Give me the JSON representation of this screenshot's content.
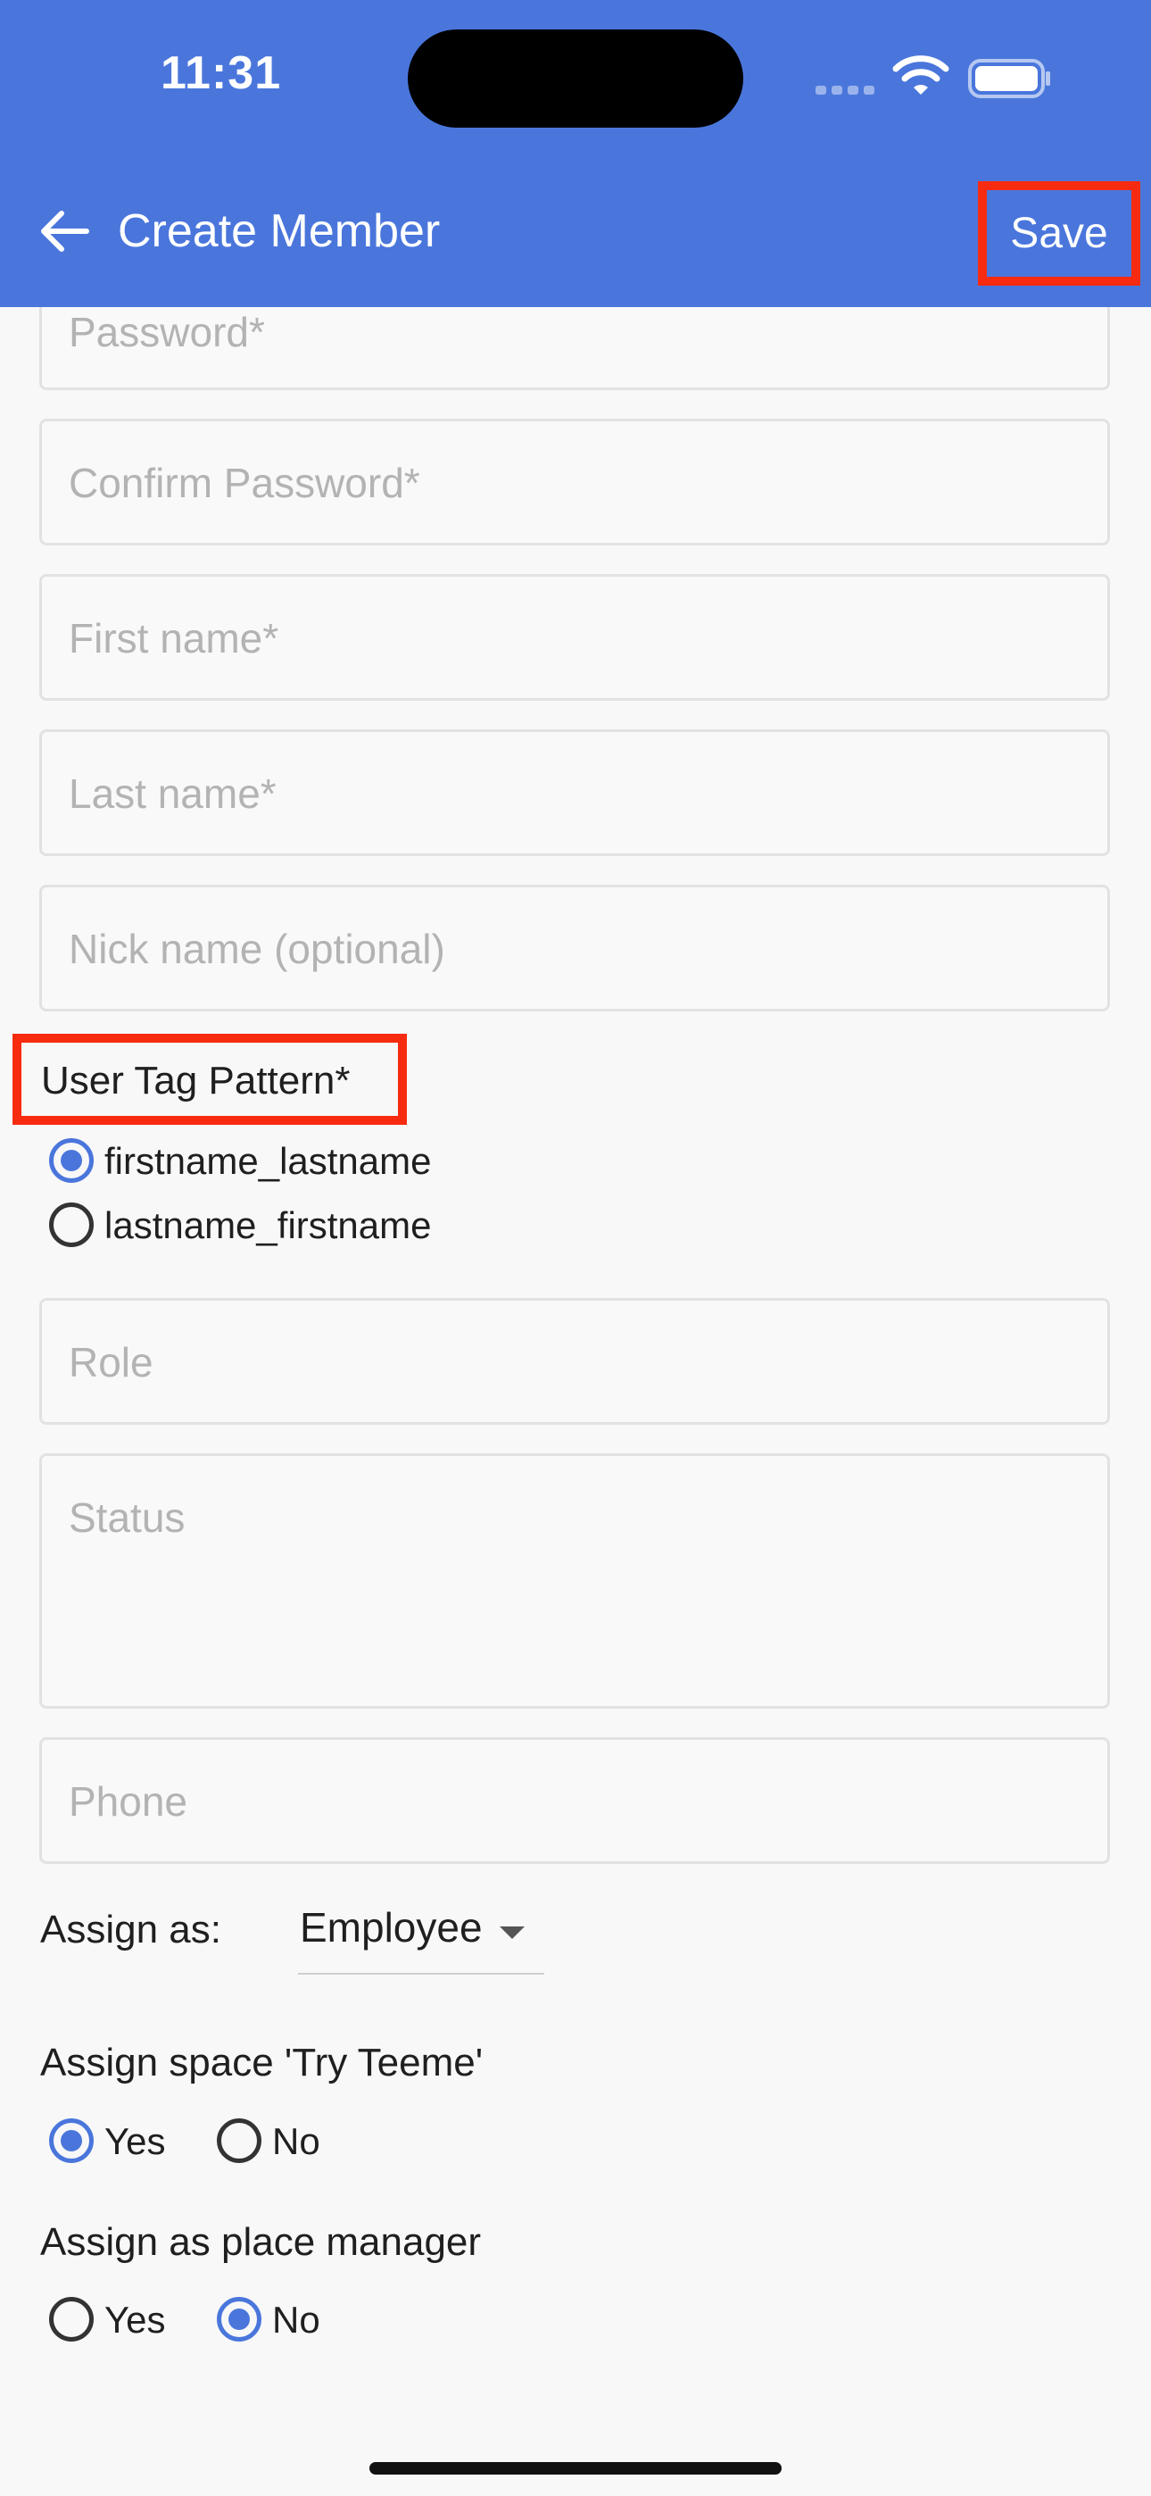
{
  "status_bar": {
    "time": "11:31"
  },
  "app_bar": {
    "title": "Create Member",
    "save_label": "Save"
  },
  "form": {
    "password_placeholder": "Password*",
    "confirm_password_placeholder": "Confirm Password*",
    "first_name_placeholder": "First name*",
    "last_name_placeholder": "Last name*",
    "nick_name_placeholder": "Nick name (optional)",
    "user_tag_pattern": {
      "label": "User Tag Pattern*",
      "options": [
        "firstname_lastname",
        "lastname_firstname"
      ],
      "selected": "firstname_lastname"
    },
    "role_placeholder": "Role",
    "status_placeholder": "Status",
    "phone_placeholder": "Phone",
    "assign_as": {
      "label": "Assign as:",
      "value": "Employee"
    },
    "assign_space": {
      "label": "Assign space 'Try Teeme'",
      "yes_label": "Yes",
      "no_label": "No",
      "selected": "Yes"
    },
    "assign_place_manager": {
      "label": "Assign as place manager",
      "yes_label": "Yes",
      "no_label": "No",
      "selected": "No"
    }
  },
  "colors": {
    "primary": "#4a76dc",
    "highlight": "#f72b10",
    "background": "#f8f8f8"
  }
}
